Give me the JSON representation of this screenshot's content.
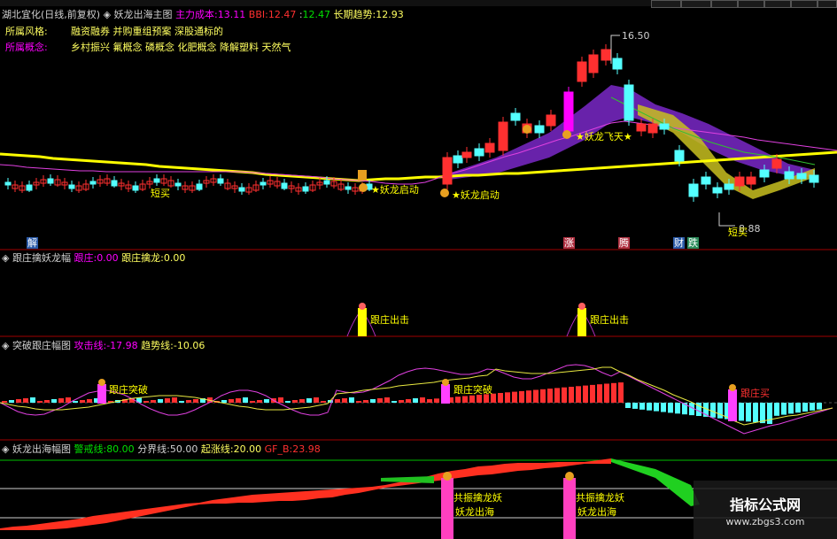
{
  "panel1": {
    "stock": "湖北宜化(日线,前复权)",
    "indicator": "妖龙出海主图",
    "cost_label": "主力成本:",
    "cost_value": "13.11",
    "bbi_label": "BBI:",
    "bbi_value": "12.47",
    "bbi_value2": "12.47",
    "trend_label": "长期趋势:",
    "trend_value": "12.93",
    "style_label": "所属风格:",
    "style_value": "融资融券 并购重组预案 深股通标的",
    "concept_label": "所属概念:",
    "concept_value": "乡村振兴 氟概念 磷概念 化肥概念 降解塑料 天然气",
    "high_label": "16.50",
    "low_label": "8.88",
    "ann_qidong": "★妖龙启动",
    "ann_qidong2": "★妖龙启动",
    "ann_feitian": "★妖龙飞天★",
    "ann_duanmai1": "短买",
    "ann_duanmai2": "短买",
    "flag_jie": "解",
    "flag_zhang": "涨",
    "flag_teng": "腾",
    "flag_cai": "财",
    "flag_die": "跌"
  },
  "panel2": {
    "name": "跟庄擒妖龙幅",
    "l1": "跟庄:",
    "v1": "0.00",
    "l2": "跟庄擒龙:",
    "v2": "0.00",
    "sig1": "跟庄出击",
    "sig2": "跟庄出击"
  },
  "panel3": {
    "name": "突破跟庄幅图",
    "l1": "攻击线:",
    "v1": "-17.98",
    "l2": "趋势线:",
    "v2": "-10.06",
    "sig1": "跟庄突破",
    "sig2": "跟庄突破",
    "sig3": "跟庄买"
  },
  "panel4": {
    "name": "妖龙出海幅图",
    "l1": "警戒线:",
    "v1": "80.00",
    "l2": "分界线:",
    "v2": "50.00",
    "l3": "起涨线:",
    "v3": "20.00",
    "l4": "GF_B:",
    "v4": "23.98",
    "sig_a1": "共振擒龙妖",
    "sig_a2": "妖龙出海",
    "sig_b1": "共振擒龙妖",
    "sig_b2": "妖龙出海"
  },
  "watermark": {
    "title": "指标公式网",
    "url": "www.zbgs3.com"
  },
  "colors": {
    "up": "#ff3030",
    "down": "#54ffff",
    "yellow": "#ffff00",
    "magenta": "#ff00ff",
    "green": "#00c000",
    "purple": "#8a2be2"
  },
  "chart_data": {
    "type": "candlestick",
    "price_high": 16.5,
    "price_low": 8.88,
    "indicators": [
      "主力成本",
      "BBI",
      "长期趋势"
    ]
  }
}
